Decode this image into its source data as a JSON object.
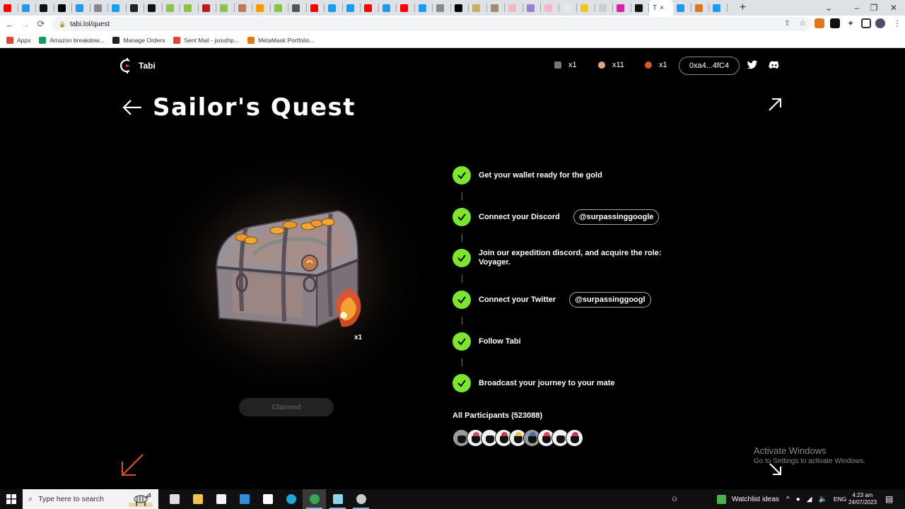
{
  "browser": {
    "tabs": [
      {
        "icon": "youtube-icon",
        "color": "#ff0000"
      },
      {
        "icon": "twitter-icon",
        "color": "#1d9bf0"
      },
      {
        "icon": "ai-app-icon",
        "color": "#111111"
      },
      {
        "icon": "medium-icon",
        "color": "#000000"
      },
      {
        "icon": "twitter-icon",
        "color": "#1d9bf0"
      },
      {
        "icon": "tabi-icon",
        "color": "#888888"
      },
      {
        "icon": "twitter-icon",
        "color": "#1d9bf0"
      },
      {
        "icon": "github-icon",
        "color": "#222222"
      },
      {
        "icon": "ai-app-icon",
        "color": "#111111"
      },
      {
        "icon": "green-app-icon",
        "color": "#8bc34a"
      },
      {
        "icon": "green-app-icon",
        "color": "#8bc34a"
      },
      {
        "icon": "red-circle-icon",
        "color": "#b71c1c"
      },
      {
        "icon": "green-app-icon",
        "color": "#8bc34a"
      },
      {
        "icon": "figure-icon",
        "color": "#c0785a"
      },
      {
        "icon": "fire-icon",
        "color": "#ff9800"
      },
      {
        "icon": "green-app-icon",
        "color": "#8bc34a"
      },
      {
        "icon": "globe-icon",
        "color": "#555555"
      },
      {
        "icon": "youtube-icon",
        "color": "#ff0000"
      },
      {
        "icon": "twitter-icon",
        "color": "#1d9bf0"
      },
      {
        "icon": "twitter-icon",
        "color": "#1d9bf0"
      },
      {
        "icon": "youtube-icon",
        "color": "#ff0000"
      },
      {
        "icon": "twitter-icon",
        "color": "#1d9bf0"
      },
      {
        "icon": "youtube-icon",
        "color": "#ff0000"
      },
      {
        "icon": "twitter-icon",
        "color": "#1d9bf0"
      },
      {
        "icon": "tabi-icon",
        "color": "#888888"
      },
      {
        "icon": "black-square-icon",
        "color": "#000000"
      },
      {
        "icon": "panda-icon",
        "color": "#c8b060"
      },
      {
        "icon": "llama-icon",
        "color": "#a08c78"
      },
      {
        "icon": "pink-face-icon",
        "color": "#f5b6c8"
      },
      {
        "icon": "shield-face-icon",
        "color": "#9b7fd4"
      },
      {
        "icon": "pink-face-icon",
        "color": "#f5b6c8"
      },
      {
        "icon": "white-blob-icon",
        "color": "#e8e8e8"
      },
      {
        "icon": "bolt-icon",
        "color": "#f5c518"
      },
      {
        "icon": "dash-icon",
        "color": "#cccccc"
      },
      {
        "icon": "instagram-icon",
        "color": "#d6249f"
      },
      {
        "icon": "ai-app-icon",
        "color": "#111111"
      }
    ],
    "active_tab": {
      "letter": "T",
      "close": "×"
    },
    "tabs_after": [
      {
        "icon": "twitter-icon",
        "color": "#1d9bf0"
      },
      {
        "icon": "metamask-icon",
        "color": "#e2761b"
      },
      {
        "icon": "twitter-icon",
        "color": "#1d9bf0"
      }
    ],
    "new_tab": "+",
    "window_controls": {
      "dropdown": "⌄",
      "minimize": "–",
      "restore": "❐",
      "close": "✕"
    },
    "nav": {
      "back": "←",
      "forward": "→",
      "reload": "⟳"
    },
    "url": "tabi.lol/quest",
    "bookmarks": [
      {
        "label": "Apps",
        "color": "#e94235"
      },
      {
        "label": "Amazon breakdow...",
        "color": "#0f9d58"
      },
      {
        "label": "Manage Orders",
        "color": "#222222"
      },
      {
        "label": "Sent Mail - jsouthp...",
        "color": "#ea4335"
      },
      {
        "label": "MetaMask Portfolio...",
        "color": "#e2761b"
      }
    ]
  },
  "header": {
    "logo_text": "Tabi",
    "inventory": [
      {
        "icon": "chest-item-icon",
        "qty": "x1",
        "color": "#777777"
      },
      {
        "icon": "egg-item-icon",
        "qty": "x11",
        "color": "#d9a77a"
      },
      {
        "icon": "fire-item-icon",
        "qty": "x1",
        "color": "#d65a2a"
      }
    ],
    "wallet": "0xa4...4fC4"
  },
  "quest": {
    "title": "Sailor's Quest",
    "reward_qty": "x1",
    "claim_button": "Claimed",
    "steps": [
      {
        "label": "Get your wallet ready for the gold",
        "done": true
      },
      {
        "label": "Connect your Discord",
        "handle": "@surpassinggoogle",
        "done": true
      },
      {
        "label": "Join our expedition discord, and acquire the role: Voyager.",
        "done": true
      },
      {
        "label": "Connect your Twitter",
        "handle": "@surpassinggoogl",
        "done": true
      },
      {
        "label": "Follow Tabi",
        "done": true
      },
      {
        "label": "Broadcast your journey to your mate",
        "done": true
      }
    ],
    "participants_label": "All Participants (523088)",
    "avatars": [
      {
        "bg": "#9a9a9a",
        "hat": ""
      },
      {
        "bg": "#f2f2f2",
        "hat": "#d8485a"
      },
      {
        "bg": "#f2f2f2",
        "hat": ""
      },
      {
        "bg": "#f2f2f2",
        "hat": "#c83a4a"
      },
      {
        "bg": "#f2f2f2",
        "hat": "#e8c24a"
      },
      {
        "bg": "#9a9a9a",
        "hat": "#4a6ab0"
      },
      {
        "bg": "#f2f2f2",
        "hat": "#d8485a"
      },
      {
        "bg": "#f2f2f2",
        "hat": ""
      },
      {
        "bg": "#f2f2f2",
        "hat": "#c83a4a"
      }
    ]
  },
  "watermark": {
    "line1": "Activate Windows",
    "line2": "Go to Settings to activate Windows."
  },
  "taskbar": {
    "search_placeholder": "Type here to search",
    "apps": [
      {
        "name": "task-view-icon",
        "color": "#dddddd"
      },
      {
        "name": "file-explorer-icon",
        "color": "#f2c14e"
      },
      {
        "name": "store-icon",
        "color": "#f3f3f3"
      },
      {
        "name": "mail-icon",
        "color": "#2d8ee0"
      },
      {
        "name": "security-icon",
        "color": "#ffffff"
      },
      {
        "name": "edge-icon",
        "color": "#1fa7d8"
      },
      {
        "name": "chrome-icon",
        "color": "#34a853"
      },
      {
        "name": "notepad-icon",
        "color": "#8fd3e8"
      },
      {
        "name": "obs-icon",
        "color": "#cccccc"
      }
    ],
    "widget": "Watchlist ideas",
    "language": "ENG",
    "time": "4:23 am",
    "date": "24/07/2023"
  },
  "colors": {
    "accent_green": "#7ce52d",
    "arrow_orange": "#e2512a"
  }
}
